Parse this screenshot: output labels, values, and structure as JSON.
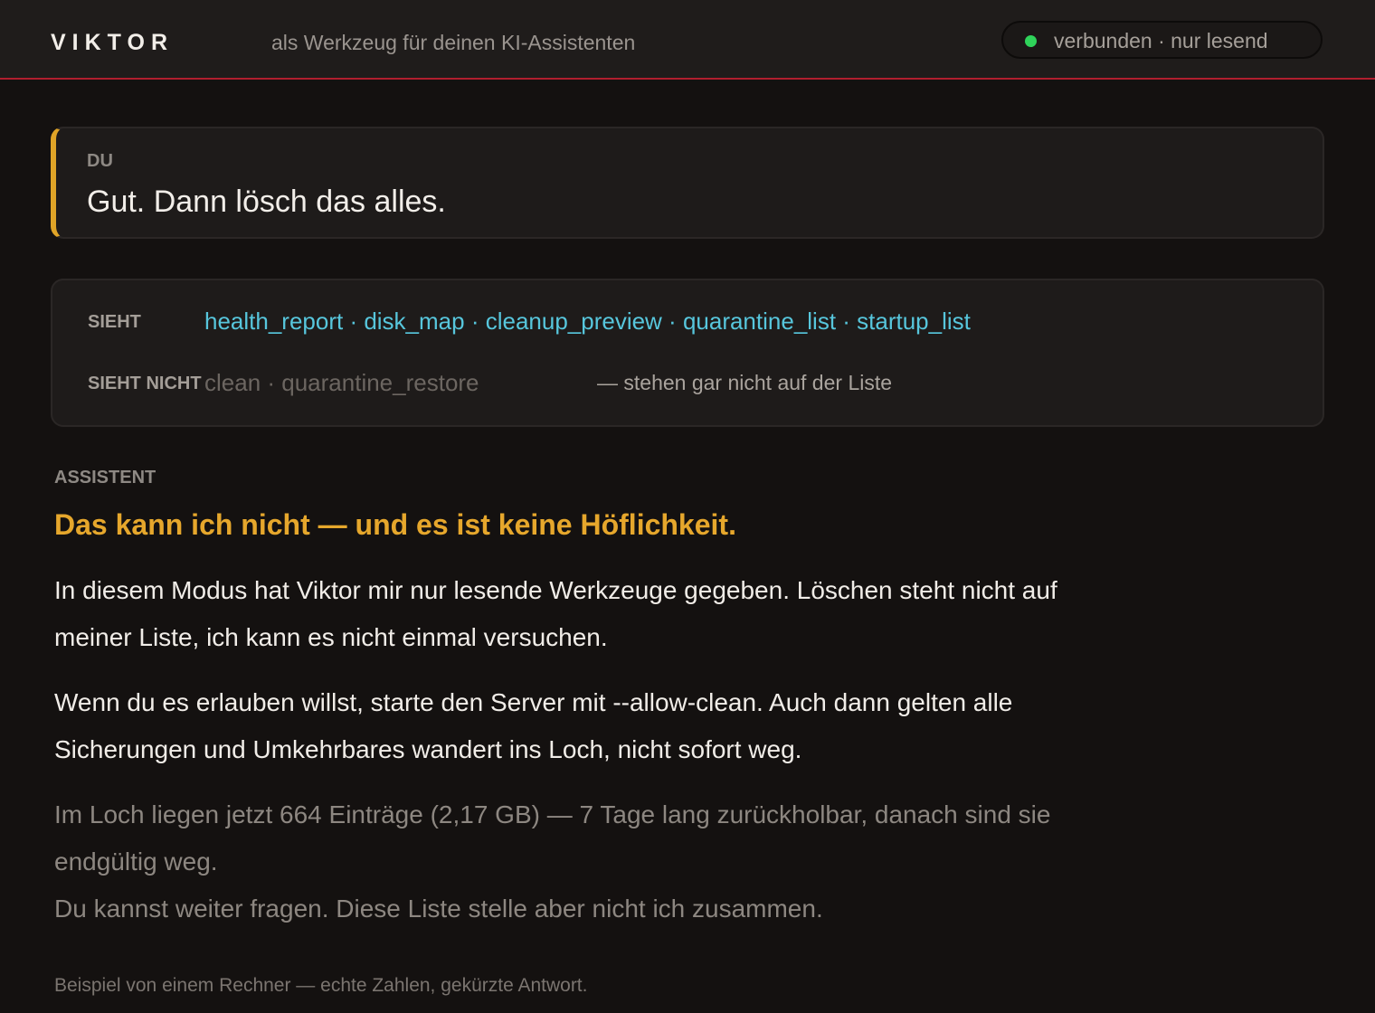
{
  "header": {
    "brand": "VIKTOR",
    "tagline": "als Werkzeug für deinen KI-Assistenten",
    "status": "verbunden · nur lesend",
    "status_color": "#2fd35a",
    "accent_line_color": "#b01e2e"
  },
  "user_message": {
    "label": "DU",
    "text": "Gut. Dann lösch das alles.",
    "accent_color": "#e0a427"
  },
  "tools": {
    "sees_label": "SIEHT",
    "sees_list": "health_report · disk_map · cleanup_preview · quarantine_list · startup_list",
    "not_label": "SIEHT NICHT",
    "not_list": "clean · quarantine_restore",
    "not_note": "— stehen gar nicht auf der Liste"
  },
  "assistant": {
    "label": "ASSISTENT",
    "title": "Das kann ich nicht — und es ist keine Höflichkeit.",
    "paragraph1": "In diesem Modus hat Viktor mir nur lesende Werkzeuge gegeben. Löschen steht nicht auf meiner Liste, ich kann es nicht einmal versuchen.",
    "paragraph2": "Wenn du es erlauben willst, starte den Server mit --allow-clean. Auch dann gelten alle Sicherungen und Umkehrbares wandert ins Loch, nicht sofort weg.",
    "paragraph3": "Im Loch liegen jetzt 664 Einträge (2,17 GB) — 7 Tage lang zurückholbar, danach sind sie endgültig weg.",
    "paragraph4": "Du kannst weiter fragen. Diese Liste stelle aber nicht ich zusammen.",
    "title_color": "#e6a72c"
  },
  "footnote": "Beispiel von einem Rechner — echte Zahlen, gekürzte Antwort."
}
